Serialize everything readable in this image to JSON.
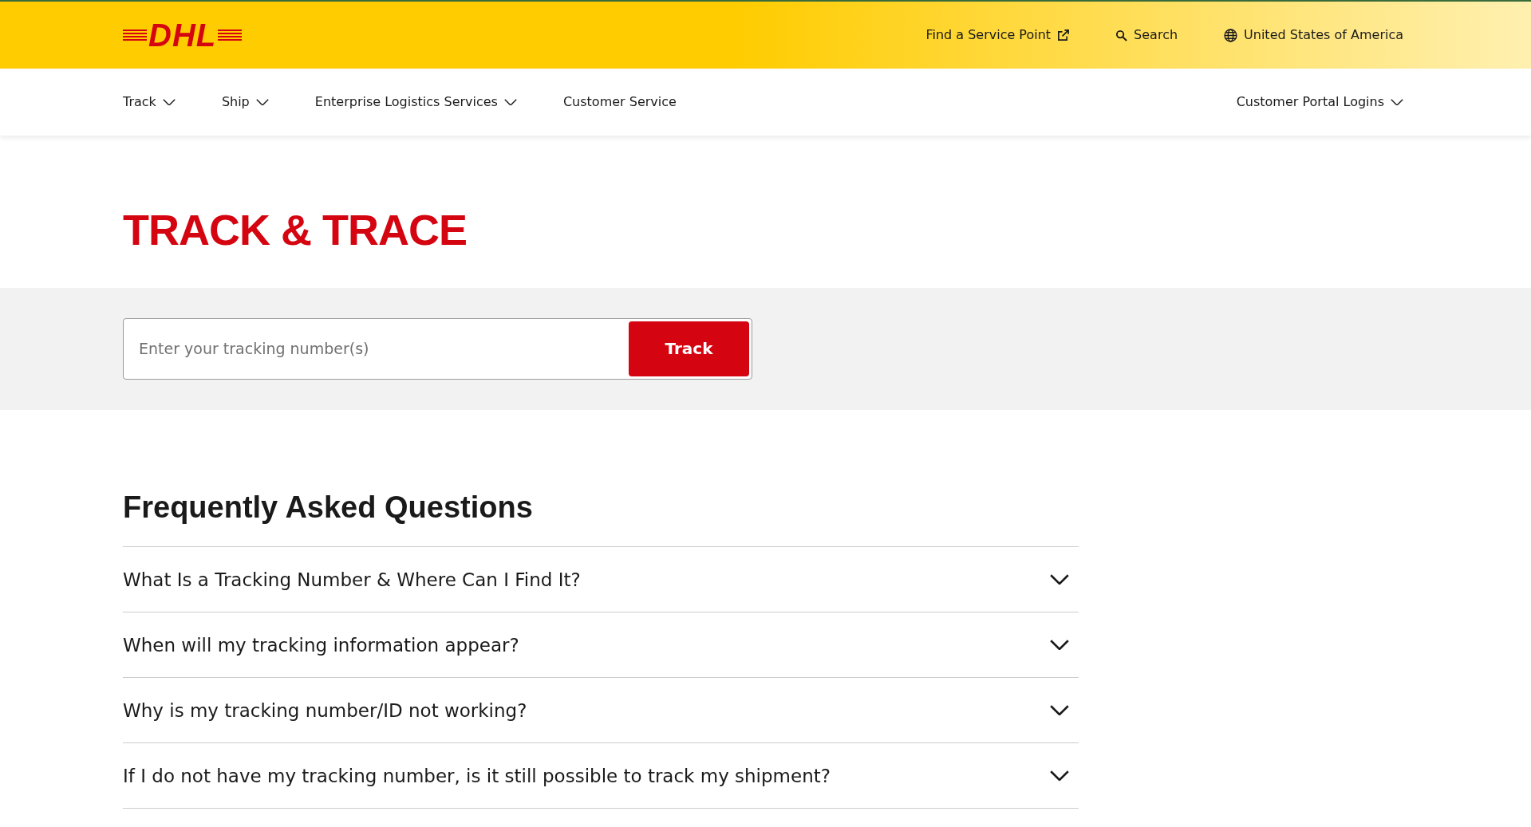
{
  "logo": {
    "text": "DHL"
  },
  "utility_links": [
    {
      "kind": "external",
      "label": "Find a Service Point"
    },
    {
      "kind": "search",
      "label": "Search"
    },
    {
      "kind": "country",
      "label": "United States of America"
    }
  ],
  "nav": {
    "items": [
      {
        "label": "Track",
        "dropdown": true
      },
      {
        "label": "Ship",
        "dropdown": true
      },
      {
        "label": "Enterprise Logistics Services",
        "dropdown": true
      },
      {
        "label": "Customer Service",
        "dropdown": false
      }
    ],
    "right_items": [
      {
        "label": "Customer Portal Logins",
        "dropdown": true
      }
    ]
  },
  "page_title": "TRACK & TRACE",
  "tracking": {
    "placeholder": "Enter your tracking number(s)",
    "button": "Track"
  },
  "faq": {
    "title": "Frequently Asked Questions",
    "items": [
      {
        "question": "What Is a Tracking Number & Where Can I Find It?",
        "expanded": false
      },
      {
        "question": "When will my tracking information appear?",
        "expanded": false
      },
      {
        "question": "Why is my tracking number/ID not working?",
        "expanded": false
      },
      {
        "question": "If I do not have my tracking number, is it still possible to track my shipment?",
        "expanded": false
      }
    ]
  }
}
